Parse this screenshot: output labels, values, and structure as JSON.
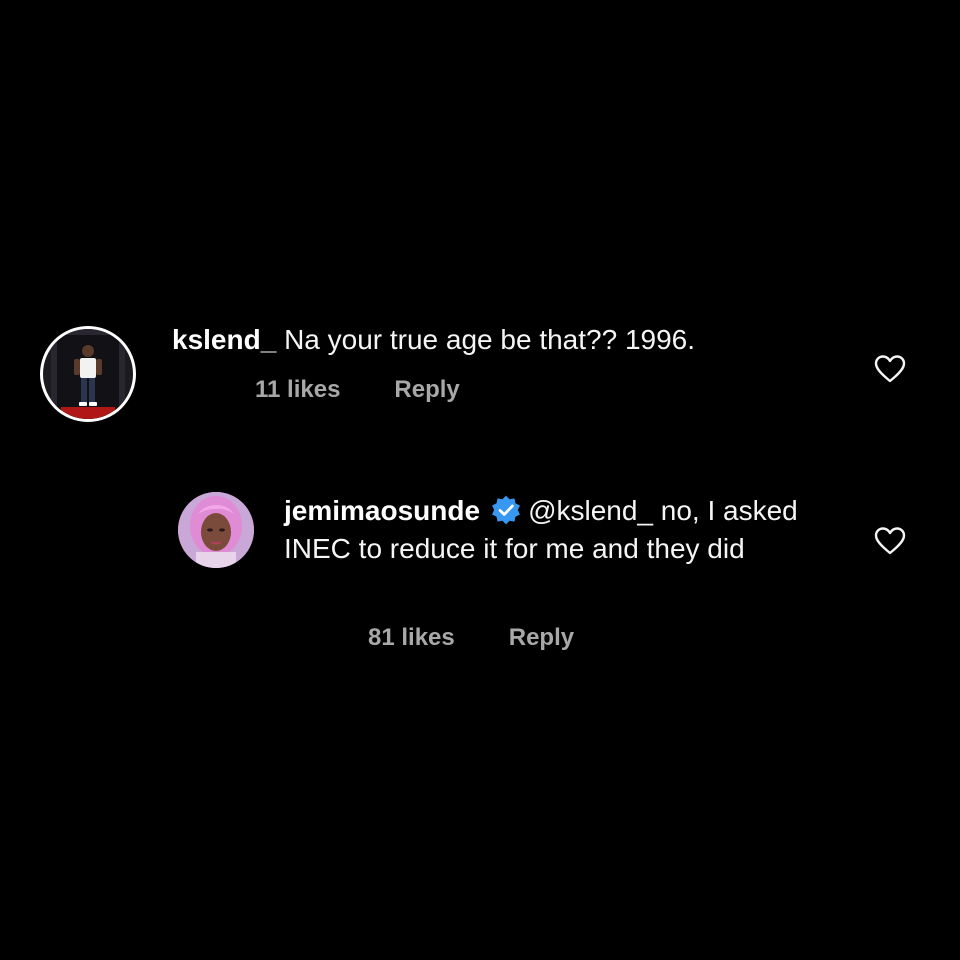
{
  "comments": [
    {
      "username": "kslend_",
      "text": "Na your true age be that?? 1996.",
      "likes": "11 likes",
      "reply_label": "Reply",
      "avatar_icon": "profile-photo-man-standing",
      "like_icon": "heart-outline-icon"
    },
    {
      "username": "jemimaosunde",
      "verified": true,
      "mention": "@kslend_",
      "text": " no, I asked INEC to reduce it for me and they did",
      "likes": "81 likes",
      "reply_label": "Reply",
      "avatar_icon": "profile-photo-woman-pink-hair",
      "like_icon": "heart-outline-icon"
    }
  ],
  "colors": {
    "background": "#000000",
    "text": "#f5f5f5",
    "meta": "#a8a8a8",
    "verified": "#3897f0"
  }
}
